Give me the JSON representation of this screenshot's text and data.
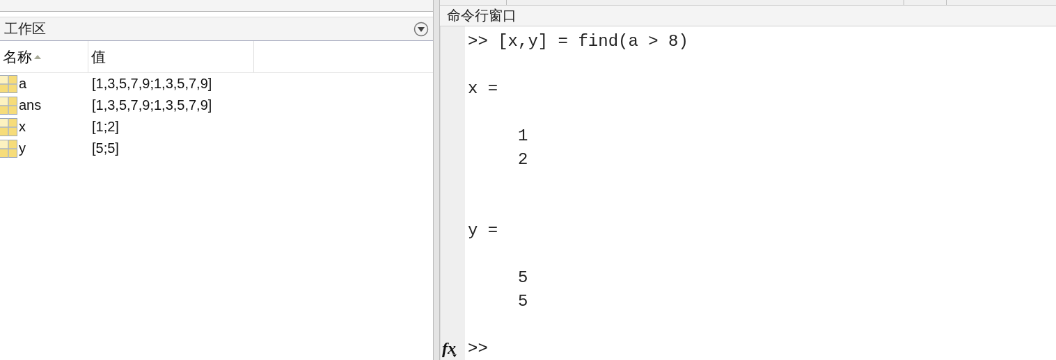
{
  "workspace": {
    "title": "工作区",
    "columns": [
      {
        "label": "名称",
        "sorted": true
      },
      {
        "label": "值",
        "sorted": false
      }
    ],
    "rows": [
      {
        "name": "a",
        "value": "[1,3,5,7,9;1,3,5,7,9]"
      },
      {
        "name": "ans",
        "value": "[1,3,5,7,9;1,3,5,7,9]"
      },
      {
        "name": "x",
        "value": "[1;2]"
      },
      {
        "name": "y",
        "value": "[5;5]"
      }
    ]
  },
  "command_window": {
    "title": "命令行窗口",
    "function_button": "fx",
    "lines": [
      {
        "kind": "command",
        "text": ">> [x,y] = find(a > 8)"
      },
      {
        "kind": "label",
        "text": "x ="
      },
      {
        "kind": "value",
        "text": "1"
      },
      {
        "kind": "value",
        "text": "2"
      },
      {
        "kind": "label",
        "text": "y ="
      },
      {
        "kind": "value",
        "text": "5"
      },
      {
        "kind": "value",
        "text": "5"
      },
      {
        "kind": "prompt",
        "text": ">>"
      }
    ]
  }
}
